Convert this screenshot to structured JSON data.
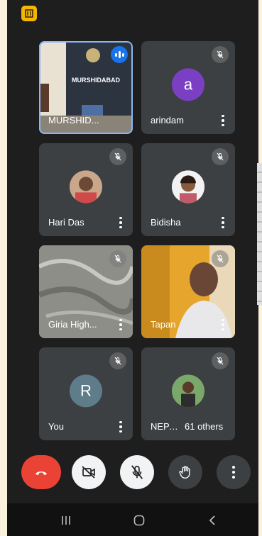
{
  "participants": [
    {
      "name": "MURSHID...",
      "banner": "MURSHIDABAD"
    },
    {
      "name": "arindam",
      "initial": "a"
    },
    {
      "name": "Hari Das"
    },
    {
      "name": "Bidisha"
    },
    {
      "name": "Giria High..."
    },
    {
      "name": "Tapan"
    },
    {
      "name": "You",
      "initial": "R"
    },
    {
      "name": "NEPA..."
    }
  ],
  "others_label": "61 others",
  "colors": {
    "end_call": "#ea4335",
    "avatar_arindam": "#7b3fc4",
    "avatar_you": "#5f7c8a",
    "speaking": "#1a73e8"
  },
  "icons": [
    "app-icon",
    "mic-off-icon",
    "more-vert-icon",
    "phone-hangup-icon",
    "video-off-icon",
    "hand-raise-icon",
    "recents-icon",
    "home-icon",
    "back-icon",
    "speaking-icon"
  ]
}
